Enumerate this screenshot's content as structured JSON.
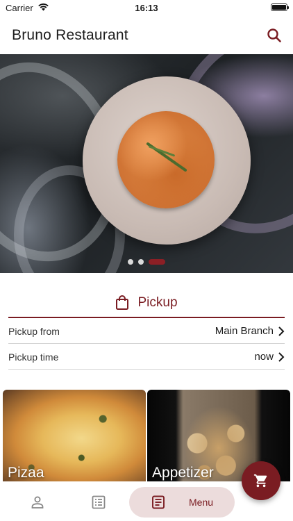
{
  "status_bar": {
    "carrier": "Carrier",
    "time": "16:13",
    "icons": [
      "wifi-icon",
      "battery-icon"
    ]
  },
  "app_bar": {
    "title": "Bruno Restaurant",
    "search_icon": "search-icon"
  },
  "hero": {
    "carousel_slides": 3,
    "active_slide": 3
  },
  "pickup": {
    "icon": "shopping-bag-icon",
    "title": "Pickup",
    "rows": [
      {
        "label": "Pickup from",
        "value": "Main Branch",
        "icon": "chevron-right-icon"
      },
      {
        "label": "Pickup time",
        "value": "now",
        "icon": "chevron-right-icon"
      }
    ]
  },
  "categories": [
    {
      "label": "Pizaa"
    },
    {
      "label": "Appetizer"
    }
  ],
  "bottom_nav": {
    "items": [
      {
        "icon": "person-icon"
      },
      {
        "icon": "orders-list-icon"
      },
      {
        "icon": "menu-icon",
        "label": "Menu",
        "selected": true
      }
    ]
  },
  "cart_fab": {
    "icon": "cart-icon"
  },
  "colors": {
    "accent": "#7a1c22",
    "menu_pill": "#ecdcdc",
    "divider": "#d4d4d4"
  }
}
